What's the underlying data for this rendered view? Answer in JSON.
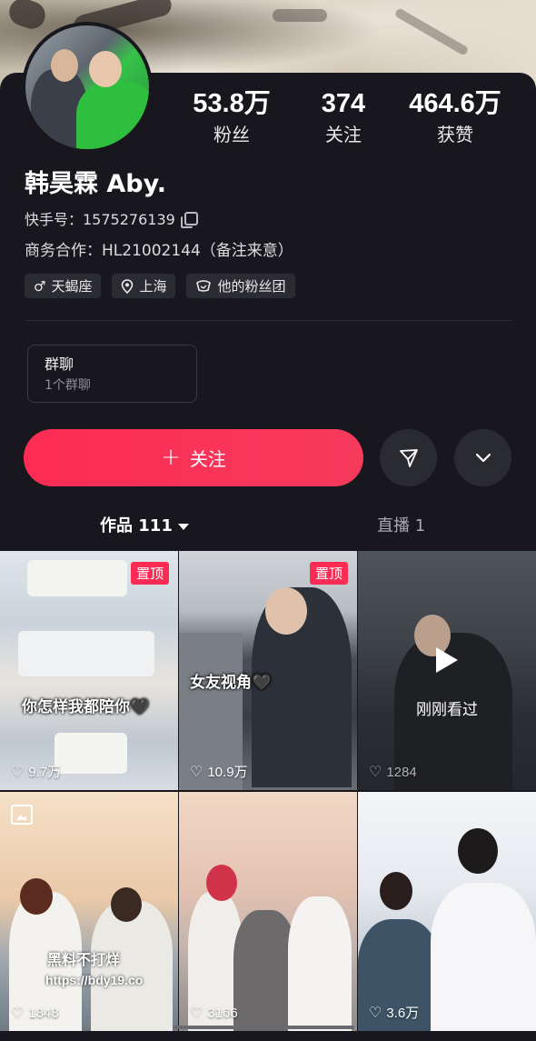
{
  "profile": {
    "name": "韩昊霖 Aby.",
    "kuaishou_label": "快手号：1575276139",
    "business": "商务合作：HL21002144（备注来意）",
    "tags": [
      "天蝎座",
      "上海",
      "他的粉丝团"
    ]
  },
  "stats": [
    {
      "value": "53.8万",
      "label": "粉丝"
    },
    {
      "value": "374",
      "label": "关注"
    },
    {
      "value": "464.6万",
      "label": "获赞"
    }
  ],
  "group_chat": {
    "title": "群聊",
    "subtitle": "1个群聊"
  },
  "actions": {
    "follow_label": "关注"
  },
  "tabs": {
    "works": "作品 111",
    "live": "直播 1"
  },
  "grid": [
    {
      "likes": "9.7万",
      "pinned": "置顶",
      "caption": "你怎样我都陪你🖤"
    },
    {
      "likes": "10.9万",
      "pinned": "置顶",
      "caption": "女友视角🖤"
    },
    {
      "likes": "1284",
      "watched": "刚刚看过"
    },
    {
      "likes": "1848"
    },
    {
      "likes": "3166"
    },
    {
      "likes": "3.6万"
    }
  ],
  "watermark": {
    "line1": "黑料不打烊",
    "line2": "https://bdy19.co"
  },
  "colors": {
    "accent": "#fe2c55",
    "background": "#17171d"
  }
}
